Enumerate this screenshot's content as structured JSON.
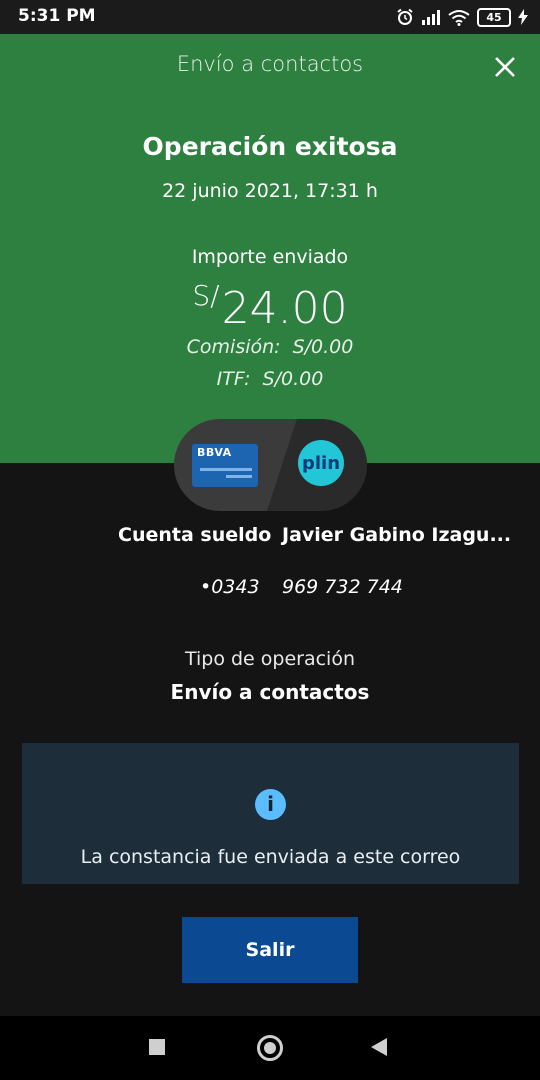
{
  "status_bar": {
    "time": "5:31 PM",
    "battery": "45"
  },
  "header": {
    "title": "Envío a contactos",
    "close_icon": "close-icon"
  },
  "operation": {
    "status": "Operación exitosa",
    "datetime": "22 junio 2021, 17:31 h",
    "amount_label": "Importe enviado",
    "currency": "S/",
    "amount": "24.00",
    "commission_label": "Comisión:",
    "commission_value": "S/0.00",
    "itf_label": "ITF:",
    "itf_value": "S/0.00"
  },
  "transfer": {
    "origin_logo": "BBVA",
    "destination_logo": "plin",
    "origin_account": "Cuenta sueldo",
    "origin_number": "•0343",
    "destination_name": "Javier Gabino Izagu...",
    "destination_number": "969 732 744"
  },
  "operation_type": {
    "label": "Tipo de operación",
    "value": "Envío a contactos"
  },
  "info_box": {
    "icon": "info-icon",
    "text": "La constancia fue enviada a este correo"
  },
  "actions": {
    "exit_label": "Salir"
  },
  "colors": {
    "header_green": "#2d8040",
    "background": "#141414",
    "button_blue": "#0b4a92",
    "info_bg": "#1d2e3a"
  }
}
